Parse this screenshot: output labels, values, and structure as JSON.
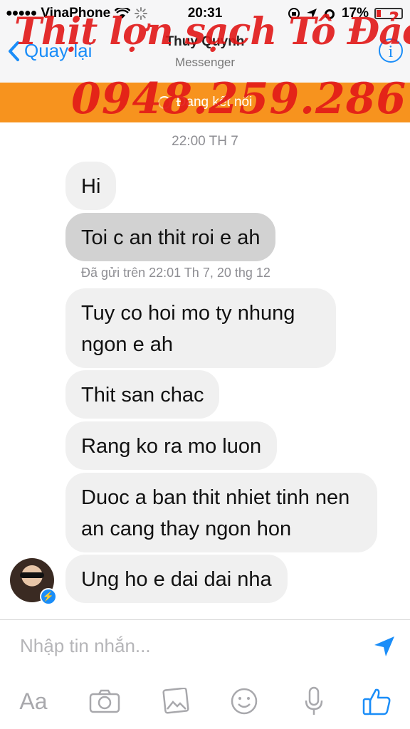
{
  "status_bar": {
    "signal_dots": "●●●●●",
    "carrier": "VinaPhone",
    "time": "20:31",
    "battery": "17%"
  },
  "nav": {
    "back_label": "Quay lại",
    "title": "Thuy Quynh",
    "subtitle": "Messenger",
    "info_label": "i"
  },
  "connection": {
    "status": "Đang kết nối"
  },
  "watermark": {
    "line1": "Thịt lợn sạch Tô Đảo",
    "line2": "0948.259.286"
  },
  "conversation": {
    "timestamp": "22:00 TH 7",
    "sent_note": "Đã gửi trên 22:01 Th 7, 20 thg 12",
    "messages": [
      "Hi",
      "Toi c an thit roi e ah",
      "Tuy co hoi mo ty nhung ngon e ah",
      "Thit san chac",
      "Rang ko ra mo luon",
      "Duoc a ban thit nhiet tinh nen an cang thay ngon hon",
      "Ung ho e dai dai nha"
    ]
  },
  "composer": {
    "placeholder": "Nhập tin nhắn...",
    "aa_label": "Aa"
  },
  "colors": {
    "accent": "#1a8df8",
    "connection_bar": "#f7931e",
    "watermark": "#e21818",
    "bubble": "#f0f0f0",
    "bubble_selected": "#d2d2d2"
  }
}
